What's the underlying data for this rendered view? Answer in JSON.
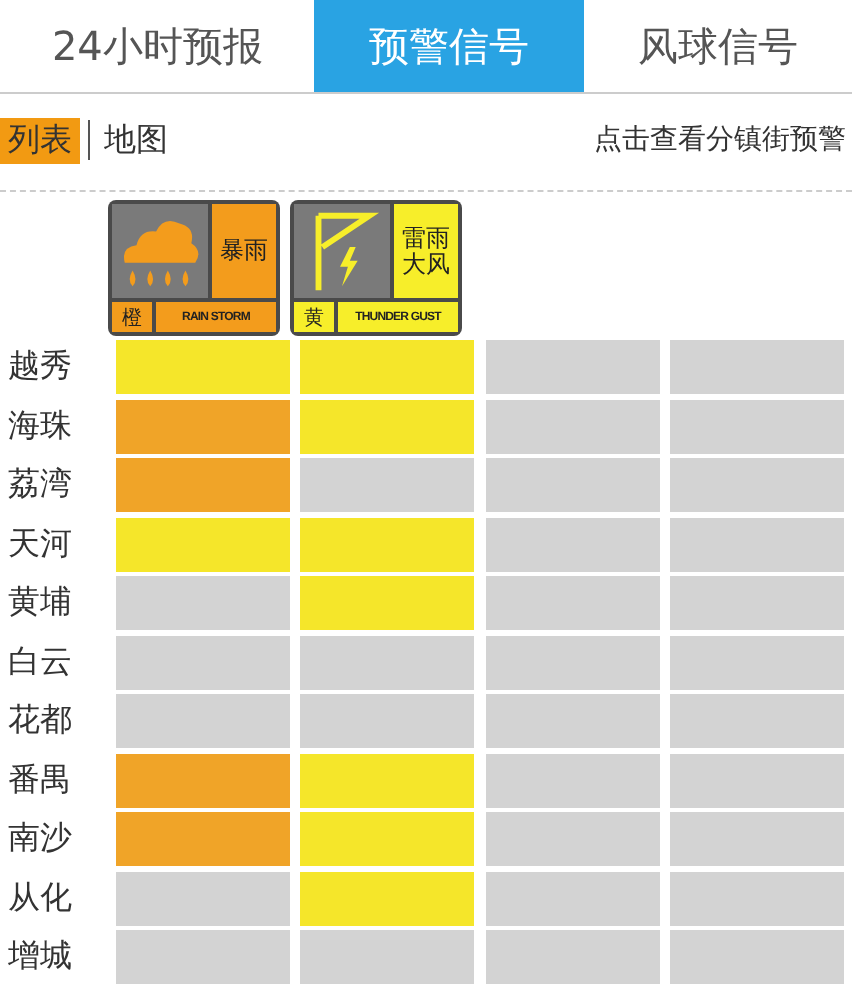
{
  "tabs": [
    {
      "label": "24小时预报",
      "selected": false
    },
    {
      "label": "预警信号",
      "selected": true
    },
    {
      "label": "风球信号",
      "selected": false
    }
  ],
  "views": [
    {
      "label": "列表",
      "selected": true
    },
    {
      "label": "地图",
      "selected": false
    }
  ],
  "district_link": "点击查看分镇街预警",
  "signals": [
    {
      "kind": "rainstorm",
      "name": "暴雨",
      "level_text": "橙",
      "english": "RAIN STORM",
      "color": "#f39c1c"
    },
    {
      "kind": "thunder",
      "name": "雷雨大风",
      "level_text": "黄",
      "english": "THUNDER GUST",
      "color": "#f7ee2a"
    }
  ],
  "rows": [
    {
      "district": "越秀",
      "cells": [
        {
          "color": "#f5e62a"
        },
        {
          "color": "#f5e62a"
        },
        {
          "color": "#d3d3d3"
        },
        {
          "color": "#d3d3d3"
        }
      ]
    },
    {
      "district": "海珠",
      "cells": [
        {
          "color": "#f0a428"
        },
        {
          "color": "#f5e62a"
        },
        {
          "color": "#d3d3d3"
        },
        {
          "color": "#d3d3d3"
        }
      ]
    },
    {
      "district": "荔湾",
      "cells": [
        {
          "color": "#f0a428"
        },
        {
          "color": "#d3d3d3"
        },
        {
          "color": "#d3d3d3"
        },
        {
          "color": "#d3d3d3"
        }
      ]
    },
    {
      "district": "天河",
      "cells": [
        {
          "color": "#f5e62a"
        },
        {
          "color": "#f5e62a"
        },
        {
          "color": "#d3d3d3"
        },
        {
          "color": "#d3d3d3"
        }
      ]
    },
    {
      "district": "黄埔",
      "cells": [
        {
          "color": "#d3d3d3"
        },
        {
          "color": "#f5e62a"
        },
        {
          "color": "#d3d3d3"
        },
        {
          "color": "#d3d3d3"
        }
      ]
    },
    {
      "district": "白云",
      "cells": [
        {
          "color": "#d3d3d3"
        },
        {
          "color": "#d3d3d3"
        },
        {
          "color": "#d3d3d3"
        },
        {
          "color": "#d3d3d3"
        }
      ]
    },
    {
      "district": "花都",
      "cells": [
        {
          "color": "#d3d3d3"
        },
        {
          "color": "#d3d3d3"
        },
        {
          "color": "#d3d3d3"
        },
        {
          "color": "#d3d3d3"
        }
      ]
    },
    {
      "district": "番禺",
      "cells": [
        {
          "color": "#f0a428"
        },
        {
          "color": "#f5e62a"
        },
        {
          "color": "#d3d3d3"
        },
        {
          "color": "#d3d3d3"
        }
      ]
    },
    {
      "district": "南沙",
      "cells": [
        {
          "color": "#f0a428"
        },
        {
          "color": "#f5e62a"
        },
        {
          "color": "#d3d3d3"
        },
        {
          "color": "#d3d3d3"
        }
      ]
    },
    {
      "district": "从化",
      "cells": [
        {
          "color": "#d3d3d3"
        },
        {
          "color": "#f5e62a"
        },
        {
          "color": "#d3d3d3"
        },
        {
          "color": "#d3d3d3"
        }
      ]
    },
    {
      "district": "增城",
      "cells": [
        {
          "color": "#d3d3d3"
        },
        {
          "color": "#d3d3d3"
        },
        {
          "color": "#d3d3d3"
        },
        {
          "color": "#d3d3d3"
        }
      ]
    }
  ]
}
